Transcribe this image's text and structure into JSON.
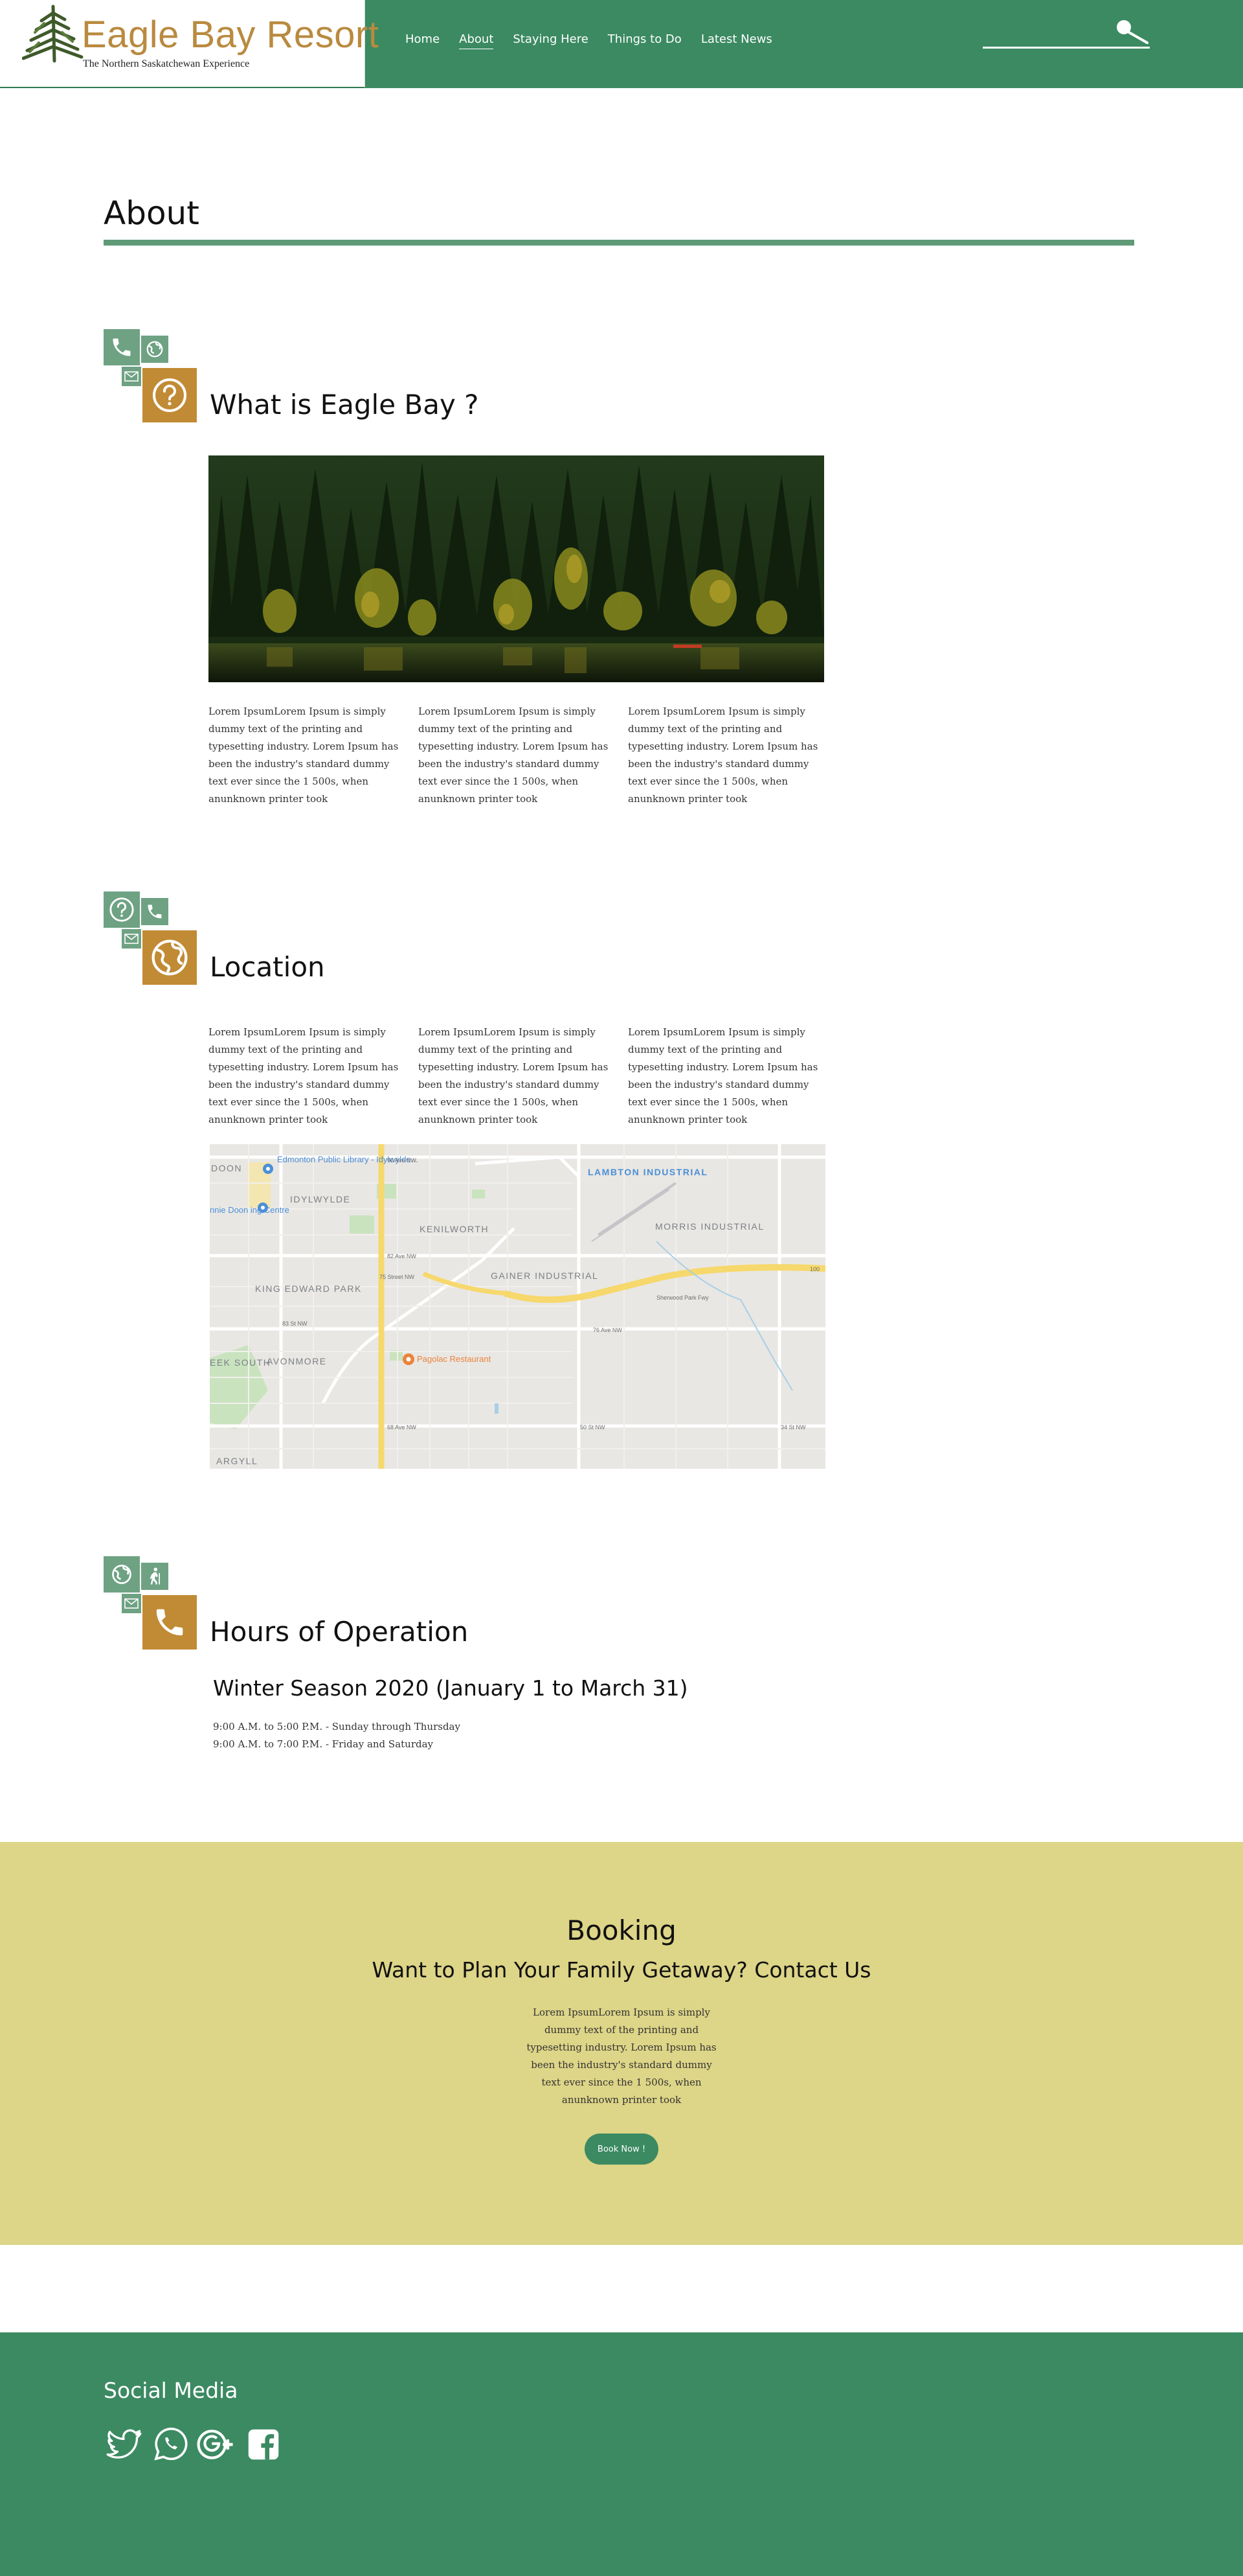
{
  "brand": {
    "name": "Eagle Bay Resort",
    "tagline": "The Northern Saskatchewan Experience",
    "colors": {
      "green": "#3b8a62",
      "gold": "#c18a34",
      "light_green": "#6ea283",
      "booking_bg": "#ddd587"
    }
  },
  "nav": {
    "items": [
      {
        "label": "Home"
      },
      {
        "label": "About",
        "active": true
      },
      {
        "label": "Staying Here"
      },
      {
        "label": "Things to Do"
      },
      {
        "label": "Latest News"
      }
    ],
    "search_icon": "magnifier-icon"
  },
  "page": {
    "title": "About"
  },
  "sections": {
    "what": {
      "heading": "What is Eagle Bay ?",
      "icons": [
        "phone-icon",
        "globe-icon",
        "mail-icon",
        "question-icon"
      ],
      "columns": [
        "Lorem IpsumLorem Ipsum is simply  dummy text of the printing and typesetting industry. Lorem Ipsum has been the industry's standard dummy text ever since the 1 500s, when anunknown printer took",
        "Lorem IpsumLorem Ipsum is simply  dummy text of the printing and typesetting industry. Lorem Ipsum has been the industry's standard dummy text ever since the 1 500s, when anunknown printer took",
        "Lorem IpsumLorem Ipsum is simply  dummy text of the printing and typesetting industry. Lorem Ipsum has been the industry's standard dummy text ever since the 1 500s, when anunknown printer took"
      ]
    },
    "location": {
      "heading": "Location",
      "icons": [
        "question-icon",
        "phone-icon",
        "mail-icon",
        "globe-icon"
      ],
      "columns": [
        "Lorem IpsumLorem Ipsum is simply  dummy text of the printing and typesetting industry. Lorem Ipsum has been the industry's standard dummy text ever since the 1 500s, when anunknown printer took",
        "Lorem IpsumLorem Ipsum is simply  dummy text of the printing and typesetting industry. Lorem Ipsum has been the industry's standard dummy text ever since the 1 500s, when anunknown printer took",
        "Lorem IpsumLorem Ipsum is simply  dummy text of the printing and typesetting industry. Lorem Ipsum has been the industry's standard dummy text ever since the 1 500s, when anunknown printer took"
      ],
      "map": {
        "labels": {
          "library": "Edmonton Public Library - Idylwylde...",
          "idylwylde": "IDYLWYLDE",
          "doon": "DOON",
          "centre": "nnie Doon ing Centre",
          "kenilworth": "KENILWORTH",
          "lambton": "LAMBTON INDUSTRIAL",
          "morris": "MORRIS INDUSTRIAL",
          "king": "KING EDWARD PARK",
          "gainer": "GAINER INDUSTRIAL",
          "avonmore": "AVONMORE",
          "bonnie": "EEK SOUTH",
          "argyll": "ARGYLL",
          "restaurant": "Pagolac Restaurant",
          "freeway": "Sherwood Park Fwy",
          "hwy": "100",
          "ave90": "90 Ave NW",
          "ave82": "82 Ave NW",
          "ave76": "76 Ave NW",
          "ave68": "68 Ave NW",
          "st75": "75 Street NW",
          "st50": "50 St NW",
          "st34": "34 St NW",
          "st83": "83 St NW"
        }
      }
    },
    "hours": {
      "heading": "Hours of Operation",
      "icons": [
        "globe-icon",
        "hiker-icon",
        "mail-icon",
        "phone-icon"
      ],
      "season": "Winter Season 2020 (January 1 to March 31)",
      "lines": [
        "9:00 A.M. to 5:00 P.M. - Sunday through Thursday",
        "9:00 A.M. to 7:00 P.M. - Friday and Saturday"
      ]
    }
  },
  "booking": {
    "title": "Booking",
    "subtitle": "Want to Plan Your Family Getaway? Contact Us",
    "text": "Lorem IpsumLorem Ipsum is simply  dummy text of the printing and typesetting industry. Lorem Ipsum has been the industry's standard dummy text ever since the 1 500s, when anunknown printer took",
    "button": "Book Now !"
  },
  "footer": {
    "social_title": "Social Media",
    "icons": [
      "twitter-icon",
      "whatsapp-icon",
      "google-plus-icon",
      "facebook-icon"
    ]
  }
}
